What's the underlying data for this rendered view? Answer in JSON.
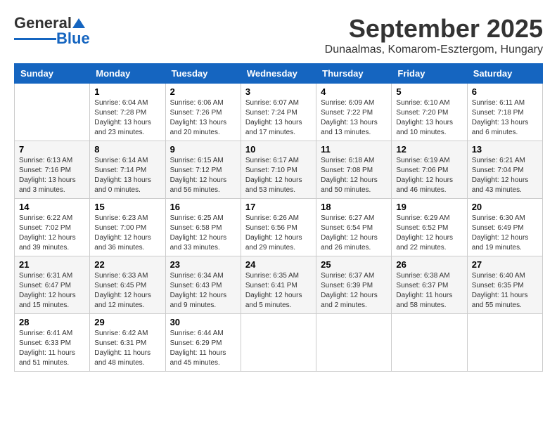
{
  "header": {
    "logo_general": "General",
    "logo_blue": "Blue",
    "month_title": "September 2025",
    "location": "Dunaalmas, Komarom-Esztergom, Hungary"
  },
  "calendar": {
    "days_of_week": [
      "Sunday",
      "Monday",
      "Tuesday",
      "Wednesday",
      "Thursday",
      "Friday",
      "Saturday"
    ],
    "weeks": [
      [
        {
          "day": "",
          "info": ""
        },
        {
          "day": "1",
          "info": "Sunrise: 6:04 AM\nSunset: 7:28 PM\nDaylight: 13 hours\nand 23 minutes."
        },
        {
          "day": "2",
          "info": "Sunrise: 6:06 AM\nSunset: 7:26 PM\nDaylight: 13 hours\nand 20 minutes."
        },
        {
          "day": "3",
          "info": "Sunrise: 6:07 AM\nSunset: 7:24 PM\nDaylight: 13 hours\nand 17 minutes."
        },
        {
          "day": "4",
          "info": "Sunrise: 6:09 AM\nSunset: 7:22 PM\nDaylight: 13 hours\nand 13 minutes."
        },
        {
          "day": "5",
          "info": "Sunrise: 6:10 AM\nSunset: 7:20 PM\nDaylight: 13 hours\nand 10 minutes."
        },
        {
          "day": "6",
          "info": "Sunrise: 6:11 AM\nSunset: 7:18 PM\nDaylight: 13 hours\nand 6 minutes."
        }
      ],
      [
        {
          "day": "7",
          "info": "Sunrise: 6:13 AM\nSunset: 7:16 PM\nDaylight: 13 hours\nand 3 minutes."
        },
        {
          "day": "8",
          "info": "Sunrise: 6:14 AM\nSunset: 7:14 PM\nDaylight: 13 hours\nand 0 minutes."
        },
        {
          "day": "9",
          "info": "Sunrise: 6:15 AM\nSunset: 7:12 PM\nDaylight: 12 hours\nand 56 minutes."
        },
        {
          "day": "10",
          "info": "Sunrise: 6:17 AM\nSunset: 7:10 PM\nDaylight: 12 hours\nand 53 minutes."
        },
        {
          "day": "11",
          "info": "Sunrise: 6:18 AM\nSunset: 7:08 PM\nDaylight: 12 hours\nand 50 minutes."
        },
        {
          "day": "12",
          "info": "Sunrise: 6:19 AM\nSunset: 7:06 PM\nDaylight: 12 hours\nand 46 minutes."
        },
        {
          "day": "13",
          "info": "Sunrise: 6:21 AM\nSunset: 7:04 PM\nDaylight: 12 hours\nand 43 minutes."
        }
      ],
      [
        {
          "day": "14",
          "info": "Sunrise: 6:22 AM\nSunset: 7:02 PM\nDaylight: 12 hours\nand 39 minutes."
        },
        {
          "day": "15",
          "info": "Sunrise: 6:23 AM\nSunset: 7:00 PM\nDaylight: 12 hours\nand 36 minutes."
        },
        {
          "day": "16",
          "info": "Sunrise: 6:25 AM\nSunset: 6:58 PM\nDaylight: 12 hours\nand 33 minutes."
        },
        {
          "day": "17",
          "info": "Sunrise: 6:26 AM\nSunset: 6:56 PM\nDaylight: 12 hours\nand 29 minutes."
        },
        {
          "day": "18",
          "info": "Sunrise: 6:27 AM\nSunset: 6:54 PM\nDaylight: 12 hours\nand 26 minutes."
        },
        {
          "day": "19",
          "info": "Sunrise: 6:29 AM\nSunset: 6:52 PM\nDaylight: 12 hours\nand 22 minutes."
        },
        {
          "day": "20",
          "info": "Sunrise: 6:30 AM\nSunset: 6:49 PM\nDaylight: 12 hours\nand 19 minutes."
        }
      ],
      [
        {
          "day": "21",
          "info": "Sunrise: 6:31 AM\nSunset: 6:47 PM\nDaylight: 12 hours\nand 15 minutes."
        },
        {
          "day": "22",
          "info": "Sunrise: 6:33 AM\nSunset: 6:45 PM\nDaylight: 12 hours\nand 12 minutes."
        },
        {
          "day": "23",
          "info": "Sunrise: 6:34 AM\nSunset: 6:43 PM\nDaylight: 12 hours\nand 9 minutes."
        },
        {
          "day": "24",
          "info": "Sunrise: 6:35 AM\nSunset: 6:41 PM\nDaylight: 12 hours\nand 5 minutes."
        },
        {
          "day": "25",
          "info": "Sunrise: 6:37 AM\nSunset: 6:39 PM\nDaylight: 12 hours\nand 2 minutes."
        },
        {
          "day": "26",
          "info": "Sunrise: 6:38 AM\nSunset: 6:37 PM\nDaylight: 11 hours\nand 58 minutes."
        },
        {
          "day": "27",
          "info": "Sunrise: 6:40 AM\nSunset: 6:35 PM\nDaylight: 11 hours\nand 55 minutes."
        }
      ],
      [
        {
          "day": "28",
          "info": "Sunrise: 6:41 AM\nSunset: 6:33 PM\nDaylight: 11 hours\nand 51 minutes."
        },
        {
          "day": "29",
          "info": "Sunrise: 6:42 AM\nSunset: 6:31 PM\nDaylight: 11 hours\nand 48 minutes."
        },
        {
          "day": "30",
          "info": "Sunrise: 6:44 AM\nSunset: 6:29 PM\nDaylight: 11 hours\nand 45 minutes."
        },
        {
          "day": "",
          "info": ""
        },
        {
          "day": "",
          "info": ""
        },
        {
          "day": "",
          "info": ""
        },
        {
          "day": "",
          "info": ""
        }
      ]
    ]
  }
}
